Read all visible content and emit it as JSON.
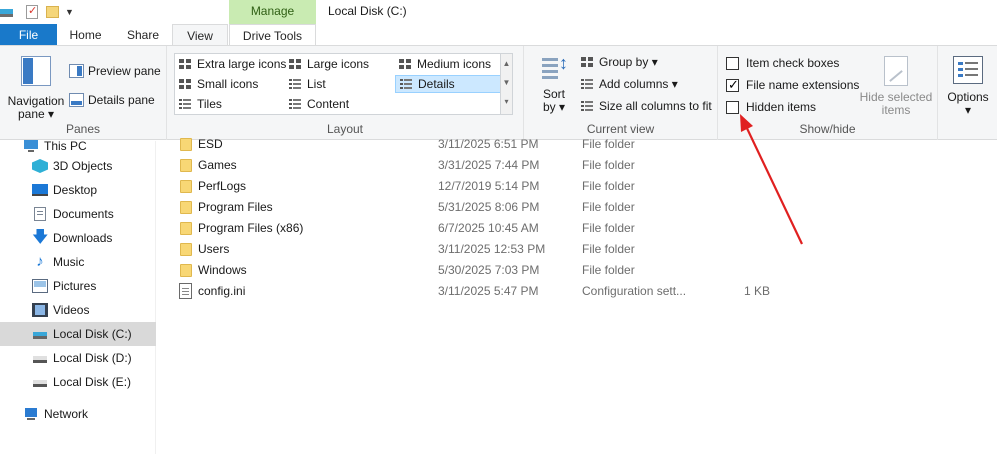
{
  "window": {
    "title": "Local Disk (C:)",
    "context_tab_group": "Manage"
  },
  "qat": {
    "icons": [
      "drive-icon",
      "properties-icon",
      "new-folder-icon",
      "customize-arrow-icon"
    ]
  },
  "tabs": {
    "file": "File",
    "home": "Home",
    "share": "Share",
    "view": "View",
    "drive_tools": "Drive Tools"
  },
  "ribbon": {
    "panes": {
      "label": "Panes",
      "navigation_pane": "Navigation",
      "navigation_pane_2": "pane ▾",
      "preview_pane": "Preview pane",
      "details_pane": "Details pane"
    },
    "layout": {
      "label": "Layout",
      "extra_large_icons": "Extra large icons",
      "large_icons": "Large icons",
      "medium_icons": "Medium icons",
      "small_icons": "Small icons",
      "list": "List",
      "details": "Details",
      "tiles": "Tiles",
      "content": "Content",
      "selected": "Details"
    },
    "current_view": {
      "label": "Current view",
      "sort_by_1": "Sort",
      "sort_by_2": "by ▾",
      "group_by": "Group by ▾",
      "add_columns": "Add columns ▾",
      "size_all_columns": "Size all columns to fit"
    },
    "show_hide": {
      "label": "Show/hide",
      "item_check_boxes": "Item check boxes",
      "item_check_boxes_checked": false,
      "file_name_extensions": "File name extensions",
      "file_name_extensions_checked": true,
      "hidden_items": "Hidden items",
      "hidden_items_checked": false,
      "hide_selected_1": "Hide selected",
      "hide_selected_2": "items"
    },
    "options": {
      "label": "Options",
      "arrow": "▾"
    }
  },
  "nav": {
    "items": [
      {
        "label": "This PC",
        "icon": "this-pc-icon"
      },
      {
        "label": "3D Objects",
        "icon": "3d-objects-icon"
      },
      {
        "label": "Desktop",
        "icon": "desktop-icon"
      },
      {
        "label": "Documents",
        "icon": "documents-icon"
      },
      {
        "label": "Downloads",
        "icon": "downloads-icon"
      },
      {
        "label": "Music",
        "icon": "music-icon"
      },
      {
        "label": "Pictures",
        "icon": "pictures-icon"
      },
      {
        "label": "Videos",
        "icon": "videos-icon"
      },
      {
        "label": "Local Disk (C:)",
        "icon": "drive-icon",
        "selected": true
      },
      {
        "label": "Local Disk (D:)",
        "icon": "drive-icon"
      },
      {
        "label": "Local Disk (E:)",
        "icon": "drive-icon"
      },
      {
        "label": "Network",
        "icon": "network-icon"
      }
    ]
  },
  "files": [
    {
      "name": "ESD",
      "date": "3/11/2025 6:51 PM",
      "type": "File folder",
      "size": ""
    },
    {
      "name": "Games",
      "date": "3/31/2025 7:44 PM",
      "type": "File folder",
      "size": ""
    },
    {
      "name": "PerfLogs",
      "date": "12/7/2019 5:14 PM",
      "type": "File folder",
      "size": ""
    },
    {
      "name": "Program Files",
      "date": "5/31/2025 8:06 PM",
      "type": "File folder",
      "size": ""
    },
    {
      "name": "Program Files (x86)",
      "date": "6/7/2025 10:45 AM",
      "type": "File folder",
      "size": ""
    },
    {
      "name": "Users",
      "date": "3/11/2025 12:53 PM",
      "type": "File folder",
      "size": ""
    },
    {
      "name": "Windows",
      "date": "5/30/2025 7:03 PM",
      "type": "File folder",
      "size": ""
    },
    {
      "name": "config.ini",
      "date": "3/11/2025 5:47 PM",
      "type": "Configuration sett...",
      "size": "1 KB"
    }
  ],
  "colors": {
    "file_tab": "#1979ca",
    "manage_tab": "#c9ebb2",
    "selection": "#cce8ff",
    "annotation_arrow": "#e02020"
  }
}
